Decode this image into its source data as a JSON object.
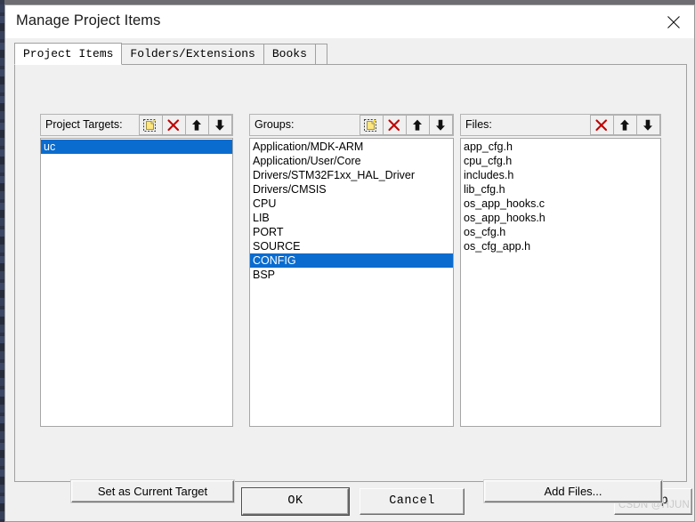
{
  "window": {
    "title": "Manage Project Items",
    "close_icon": "close-icon"
  },
  "tabs": [
    {
      "label": "Project Items",
      "active": true
    },
    {
      "label": "Folders/Extensions",
      "active": false
    },
    {
      "label": "Books",
      "active": false
    }
  ],
  "panes": {
    "targets": {
      "header": "Project Targets:",
      "tools": [
        "new-item-icon",
        "delete-icon",
        "move-up-icon",
        "move-down-icon"
      ],
      "items": [
        {
          "label": "uc",
          "selected": true
        }
      ]
    },
    "groups": {
      "header": "Groups:",
      "tools": [
        "new-item-icon",
        "delete-icon",
        "move-up-icon",
        "move-down-icon"
      ],
      "items": [
        {
          "label": "Application/MDK-ARM",
          "selected": false
        },
        {
          "label": "Application/User/Core",
          "selected": false
        },
        {
          "label": "Drivers/STM32F1xx_HAL_Driver",
          "selected": false
        },
        {
          "label": "Drivers/CMSIS",
          "selected": false
        },
        {
          "label": "CPU",
          "selected": false
        },
        {
          "label": "LIB",
          "selected": false
        },
        {
          "label": "PORT",
          "selected": false
        },
        {
          "label": "SOURCE",
          "selected": false
        },
        {
          "label": "CONFIG",
          "selected": true
        },
        {
          "label": "BSP",
          "selected": false
        }
      ]
    },
    "files": {
      "header": "Files:",
      "tools": [
        "delete-icon",
        "move-up-icon",
        "move-down-icon"
      ],
      "items": [
        {
          "label": "app_cfg.h",
          "selected": false
        },
        {
          "label": "cpu_cfg.h",
          "selected": false
        },
        {
          "label": "includes.h",
          "selected": false
        },
        {
          "label": "lib_cfg.h",
          "selected": false
        },
        {
          "label": "os_app_hooks.c",
          "selected": false
        },
        {
          "label": "os_app_hooks.h",
          "selected": false
        },
        {
          "label": "os_cfg.h",
          "selected": false
        },
        {
          "label": "os_cfg_app.h",
          "selected": false
        }
      ]
    }
  },
  "buttons": {
    "set_as_current_target": "Set as Current Target",
    "add_files": "Add Files...",
    "ok": "OK",
    "cancel": "Cancel",
    "help": "Help"
  },
  "watermark": "CSDN @HJUN",
  "colors": {
    "selection_blue": "#0a6ccf",
    "dialog_face": "#f0f0f0",
    "delete_icon_red": "#c00000",
    "new_icon_yellow": "#ffe680"
  }
}
